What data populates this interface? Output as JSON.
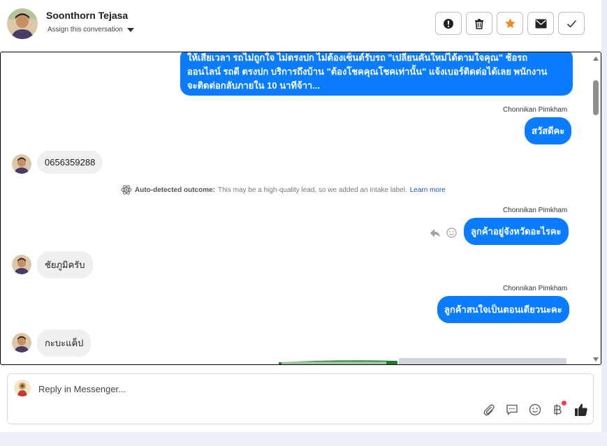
{
  "header": {
    "contact_name": "Soonthorn Tejasa",
    "assign_label": "Assign this conversation",
    "actions": [
      {
        "name": "report-button",
        "icon": "exclamation-icon"
      },
      {
        "name": "delete-button",
        "icon": "trash-icon"
      },
      {
        "name": "star-button",
        "icon": "star-icon",
        "color": "#f08a24"
      },
      {
        "name": "mark-unread-button",
        "icon": "envelope-icon"
      },
      {
        "name": "mark-done-button",
        "icon": "check-icon"
      }
    ]
  },
  "messages": [
    {
      "type": "outgoing",
      "text_lines": [
        "ให้เสียเวลา รถไม่ถูกใจ ไม่ตรงปก ไม่ต้องเซ็นต์รับรถ \"เปลี่ยนคันใหม่ได้ตามใจคุณ\" ช้อรถ",
        "ออนไลน์ รถดี ตรงปก บริการถึงบ้าน \"ต้องโชคคุณโชคเท่านั้น\" แจ้งเบอร์ติดต่อได้เลย พนักงาน",
        "จะติดต่อกลับภายใน 10 นาทีจ้าา..."
      ]
    },
    {
      "type": "outgoing",
      "sender": "Chonnikan Pimkham",
      "text": "สวัสดีคะ"
    },
    {
      "type": "incoming",
      "text": "0656359288"
    },
    {
      "type": "system",
      "title": "Auto-detected outcome:",
      "text": "This may be a high-quality lead, so we added an intake label.",
      "link": "Learn more"
    },
    {
      "type": "outgoing",
      "sender": "Chonnikan Pimkham",
      "text": "ลูกค้าอยู่จังหวัดอะไรคะ"
    },
    {
      "type": "incoming",
      "text": "ชัยภูมิครับ"
    },
    {
      "type": "outgoing",
      "sender": "Chonnikan Pimkham",
      "text": "ลูกค้าสนใจเป็นตอนเดียวนะคะ"
    },
    {
      "type": "incoming",
      "text": "กะบะแค็ป"
    }
  ],
  "composer": {
    "placeholder": "Reply in Messenger...",
    "tools": [
      "paperclip-icon",
      "saved-reply-icon",
      "emoji-icon",
      "baht-payment-icon",
      "thumbs-up-icon"
    ]
  },
  "colors": {
    "outgoing_bubble": "#0a7cff",
    "incoming_bubble": "#efefef",
    "link": "#1f5aa8"
  }
}
